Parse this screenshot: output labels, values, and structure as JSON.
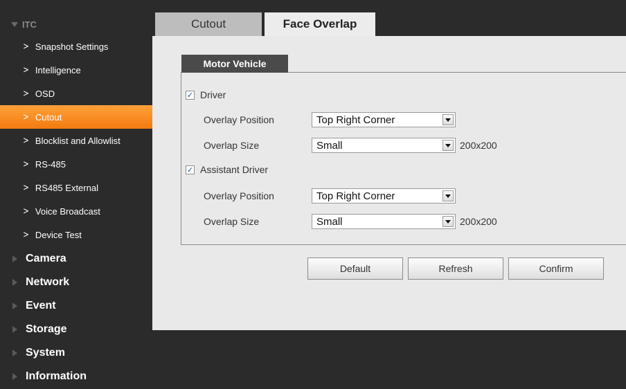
{
  "sidebar": {
    "itc_label": "ITC",
    "sub_items": [
      {
        "label": "Snapshot Settings"
      },
      {
        "label": "Intelligence"
      },
      {
        "label": "OSD"
      },
      {
        "label": "Cutout"
      },
      {
        "label": "Blocklist and Allowlist"
      },
      {
        "label": "RS-485"
      },
      {
        "label": "RS485 External"
      },
      {
        "label": "Voice Broadcast"
      },
      {
        "label": "Device Test"
      }
    ],
    "sections": [
      {
        "label": "Camera"
      },
      {
        "label": "Network"
      },
      {
        "label": "Event"
      },
      {
        "label": "Storage"
      },
      {
        "label": "System"
      },
      {
        "label": "Information"
      }
    ]
  },
  "tabs": {
    "cutout": "Cutout",
    "face_overlap": "Face Overlap"
  },
  "subtab": "Motor Vehicle",
  "driver": {
    "label": "Driver",
    "checked": true,
    "overlay_position_label": "Overlay Position",
    "overlay_position_value": "Top Right Corner",
    "overlap_size_label": "Overlap Size",
    "overlap_size_value": "Small",
    "size_hint": "200x200"
  },
  "assistant_driver": {
    "label": "Assistant Driver",
    "checked": true,
    "overlay_position_label": "Overlay Position",
    "overlay_position_value": "Top Right Corner",
    "overlap_size_label": "Overlap Size",
    "overlap_size_value": "Small",
    "size_hint": "200x200"
  },
  "buttons": {
    "default": "Default",
    "refresh": "Refresh",
    "confirm": "Confirm"
  },
  "colors": {
    "active_item": "#f27a10",
    "sidebar_bg": "#2b2b2b",
    "content_bg": "#e9e9e9"
  }
}
